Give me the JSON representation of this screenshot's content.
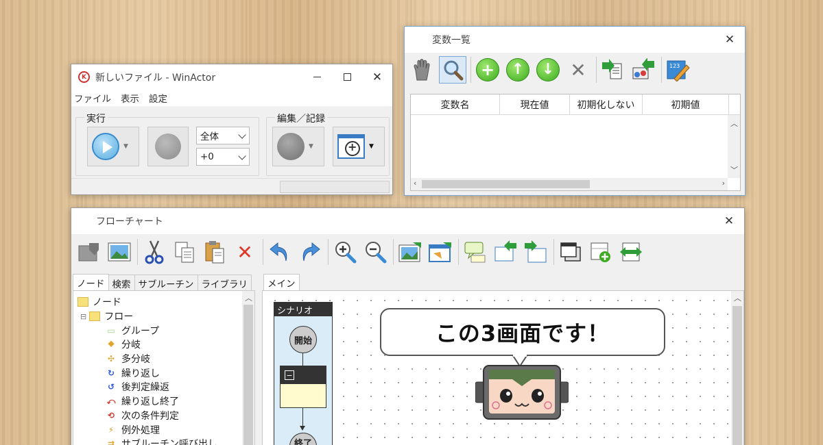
{
  "main_window": {
    "title": "新しいファイル - WinActor",
    "logo_text": "K",
    "menu": [
      "ファイル",
      "表示",
      "設定"
    ],
    "run_group": {
      "label": "実行",
      "scope_select": "全体",
      "speed_select": "+0"
    },
    "edit_group": {
      "label": "編集／記録"
    }
  },
  "variables_window": {
    "title": "変数一覧",
    "toolbar_icons": [
      "hand-icon",
      "search-icon",
      "add-icon",
      "move-up-icon",
      "move-down-icon",
      "delete-icon",
      "import-icon",
      "export-icon",
      "value-edit-icon"
    ],
    "columns": [
      "変数名",
      "現在値",
      "初期化しない",
      "初期値"
    ],
    "rows": []
  },
  "flowchart_window": {
    "title": "フローチャート",
    "left_tabs": [
      "ノード",
      "検索",
      "サブルーチン",
      "ライブラリ"
    ],
    "tree": [
      {
        "label": "ノード",
        "level": 0,
        "icon": "folder-icon"
      },
      {
        "label": "フロー",
        "level": 1,
        "icon": "folder-icon",
        "expander": "⊟"
      },
      {
        "label": "グループ",
        "level": 2,
        "icon": "group-icon"
      },
      {
        "label": "分岐",
        "level": 2,
        "icon": "branch-icon"
      },
      {
        "label": "多分岐",
        "level": 2,
        "icon": "multi-branch-icon"
      },
      {
        "label": "繰り返し",
        "level": 2,
        "icon": "loop-icon"
      },
      {
        "label": "後判定繰返",
        "level": 2,
        "icon": "post-loop-icon"
      },
      {
        "label": "繰り返し終了",
        "level": 2,
        "icon": "loop-end-icon"
      },
      {
        "label": "次の条件判定",
        "level": 2,
        "icon": "next-condition-icon"
      },
      {
        "label": "例外処理",
        "level": 2,
        "icon": "exception-icon"
      },
      {
        "label": "サブルーチン呼び出し",
        "level": 2,
        "icon": "subroutine-icon"
      }
    ],
    "canvas_tab": "メイン",
    "scenario": {
      "lane_title": "シナリオ",
      "start_label": "開始",
      "end_label": "終了"
    }
  },
  "overlay": {
    "speech": "この3画面です！"
  },
  "colors": {
    "accent_blue": "#3b8ccc",
    "green_button": "#3cab1e",
    "delete_red": "#e0362a",
    "wood": "#dfc195"
  }
}
